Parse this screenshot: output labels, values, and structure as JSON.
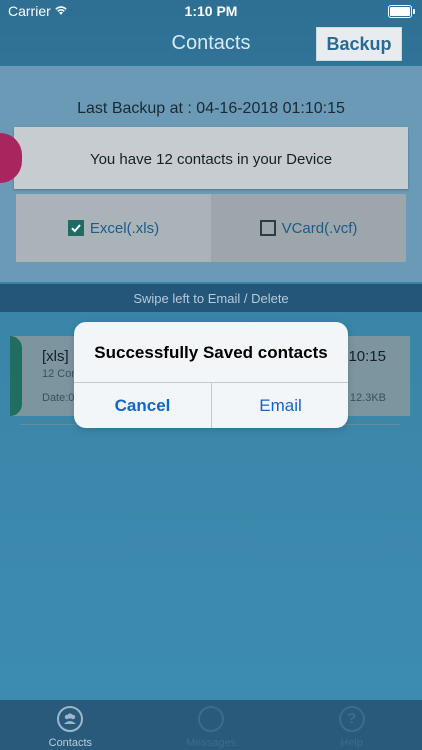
{
  "status_bar": {
    "carrier": "Carrier",
    "time": "1:10 PM"
  },
  "navbar": {
    "title": "Contacts",
    "backup_label": "Backup"
  },
  "last_backup": "Last Backup at : 04-16-2018 01:10:15",
  "device_summary": "You have 12 contacts in your Device",
  "options": [
    {
      "label": "Excel(.xls)",
      "checked": true
    },
    {
      "label": "VCard(.vcf)",
      "checked": false
    }
  ],
  "swipe_hint": "Swipe left to Email / Delete",
  "backup_item": {
    "type": "[xls]",
    "count": "12 Con",
    "date": "Date:0",
    "time": ":10:15",
    "size": "12.3KB"
  },
  "alert": {
    "title": "Successfully Saved contacts",
    "cancel_label": "Cancel",
    "email_label": "Email"
  },
  "tabbar": {
    "items": [
      {
        "label": "Contacts",
        "icon": "contacts-icon",
        "active": true
      },
      {
        "label": "Messages",
        "icon": "messages-icon",
        "active": false
      },
      {
        "label": "Help",
        "icon": "help-icon",
        "active": false
      }
    ]
  },
  "colors": {
    "accent_blue": "#1466c6",
    "nav_bg": "#2e6f93",
    "check_green": "#1d6b63",
    "magenta_accent": "#a8255d"
  }
}
